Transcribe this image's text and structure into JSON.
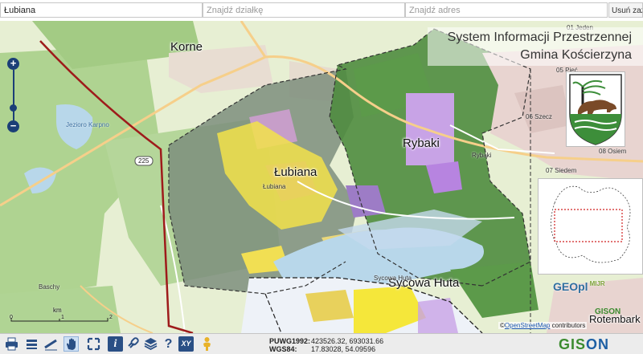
{
  "search": {
    "location_value": "Łubiana",
    "parcel_placeholder": "Znajdź działkę",
    "address_placeholder": "Znajdź adres",
    "clear_label": "Usuń zaznaczenie"
  },
  "header": {
    "title_line1": "System Informacji Przestrzennej",
    "title_line2": "Gmina Kościerzyna"
  },
  "map": {
    "labels": {
      "korne": "Korne",
      "lubiana": "Łubiana",
      "lubiana_small": "Łubiana",
      "rybaki": "Rybaki",
      "rybaki_small": "Rybaki",
      "sycowa_huta": "Sycowa Huta",
      "sycowa_small": "Sycowa Huta",
      "szecz": "06 Szecz",
      "osiem": "08 Osiem",
      "siedem": "07 Siedem",
      "piec": "05 Pięć",
      "jeden": "01 Jeden",
      "rotembark": "Rotembark",
      "baschy": "Baschy",
      "road_225": "225",
      "lake_karpno": "Jezioro Karpno"
    },
    "scale": {
      "unit": "km",
      "tick_0": "0",
      "tick_1": "1",
      "tick_2": "2"
    },
    "attribution": {
      "prefix": "©",
      "link": "OpenStreetMap",
      "suffix": " contributors"
    },
    "logo_gedpl": "GEOpl",
    "logo_gedpl_small": "MIJR",
    "logo_gison_small": "GISON"
  },
  "zoom": {
    "in": "+",
    "out": "−"
  },
  "coordinates": {
    "puwg_label": "PUWG1992:",
    "puwg_value": "423526.32, 693031.66",
    "wgs_label": "WGS84:",
    "wgs_value": "17.83028, 54.09596"
  },
  "toolbar": {
    "icons": [
      "print-icon",
      "layers-print-icon",
      "measure-icon",
      "pan-hand-icon",
      "fullscreen-icon",
      "info-icon",
      "link-icon",
      "layers-icon",
      "help-icon",
      "xy-icon",
      "person-icon"
    ],
    "xy_label": "XY",
    "help_label": "?",
    "info_label": "i"
  },
  "brand": {
    "gison_green": "GIS",
    "gison_blue": "ON"
  },
  "colors": {
    "forest": "#9cc67e",
    "gmina_area": "#6b7d6a",
    "nature_green": "#4e8b3e",
    "residential_yellow": "#f2e24a",
    "purple_zone": "#c8a3e6",
    "lake_blue": "#b8d7ea",
    "boundary_red": "#9e1b1b",
    "accent_blue": "#1b3f77"
  }
}
